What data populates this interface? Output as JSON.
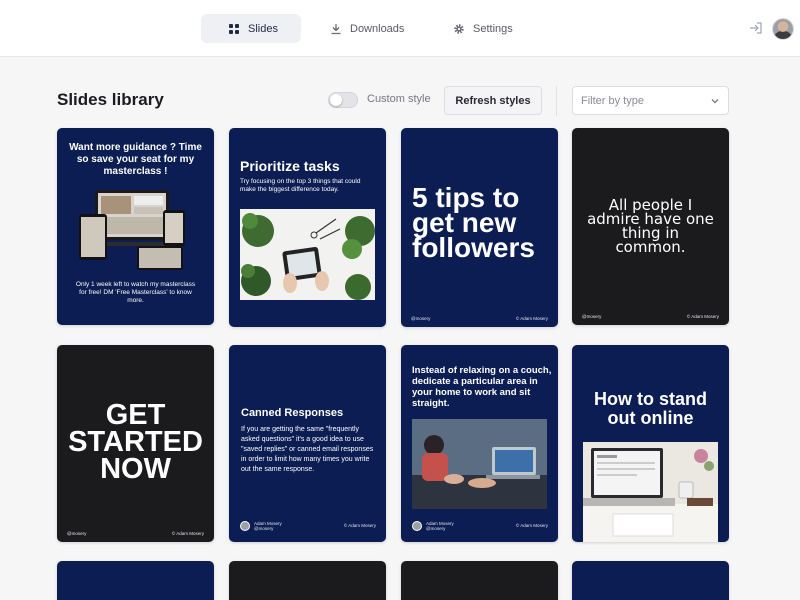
{
  "nav": {
    "tabs": [
      {
        "label": "Slides",
        "icon": "grid-icon",
        "active": true
      },
      {
        "label": "Downloads",
        "icon": "download-icon",
        "active": false
      },
      {
        "label": "Settings",
        "icon": "gear-icon",
        "active": false
      }
    ]
  },
  "library": {
    "title": "Slides library",
    "toggle_label": "Custom style",
    "refresh_label": "Refresh styles",
    "filter_placeholder": "Filter by type"
  },
  "cards": [
    {
      "title": "Want more guidance ? Time so save your seat for my masterclass !",
      "body": "Only 1 week left to watch my masterclass for free! DM 'Free Masterclass' to know more."
    },
    {
      "title": "Prioritize tasks",
      "body": "Try focusing on the top 3 things that could make the biggest difference today."
    },
    {
      "title": "5 tips to get new followers",
      "handle": "@mosery",
      "author": "© Adam Mosery"
    },
    {
      "title": "All people I admire have one thing in common.",
      "handle": "@mosery",
      "author": "© Adam Mosery"
    },
    {
      "title": "GET STARTED NOW",
      "handle": "@mosery",
      "author": "© Adam Mosery"
    },
    {
      "title": "Canned Responses",
      "body": "If you are getting the same \"frequently asked questions\" it's a good idea to use \"saved replies\" or canned email responses in order to limit how many times you write out the same response.",
      "author_name": "Adam Mosery",
      "author_handle": "@mosery",
      "author": "© Adam Mosery"
    },
    {
      "title": "Instead of relaxing on a couch, dedicate a particular area in your home to work and sit straight.",
      "author_name": "Adam Mosery",
      "author_handle": "@mosery",
      "author": "© Adam Mosery"
    },
    {
      "title": "How to stand out online"
    }
  ],
  "colors": {
    "navy": "#0b1d52",
    "dark": "#1b1b1d",
    "accent": "#1f2a44"
  }
}
